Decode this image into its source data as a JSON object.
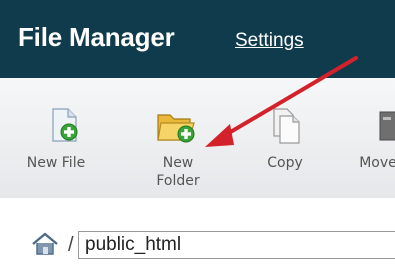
{
  "header": {
    "title": "File Manager",
    "settings_label": "Settings"
  },
  "toolbar": {
    "items": [
      {
        "label": "New File",
        "icon": "new-file-icon"
      },
      {
        "label": "New\nFolder",
        "icon": "new-folder-icon"
      },
      {
        "label": "Copy",
        "icon": "copy-icon"
      },
      {
        "label": "Move",
        "icon": "move-icon"
      }
    ]
  },
  "path_bar": {
    "current_path": "public_html",
    "home_icon": "home-icon",
    "separator": "/"
  },
  "colors": {
    "header_bg": "#0f3b4c",
    "annotation_arrow": "#d4222a"
  }
}
